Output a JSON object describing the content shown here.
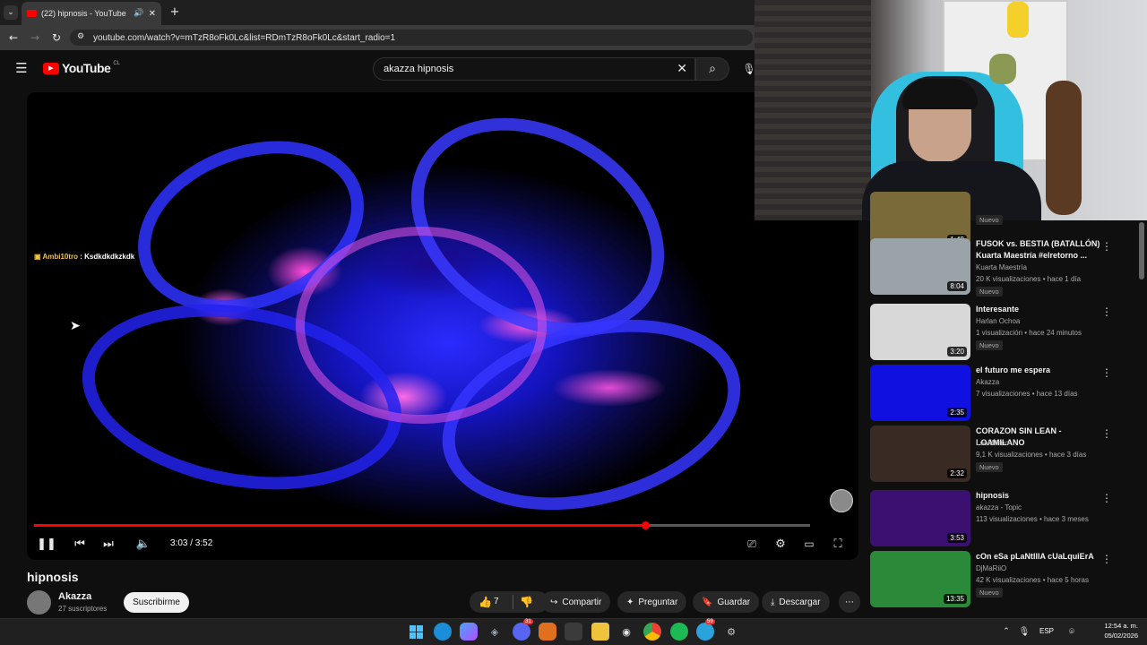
{
  "browser": {
    "tab_title": "(22) hipnosis - YouTube",
    "url": "youtube.com/watch?v=mTzR8oFk0Lc&list=RDmTzR8oFk0Lc&start_radio=1"
  },
  "header": {
    "logo_text": "YouTube",
    "country_code": "CL",
    "search_value": "akazza hipnosis"
  },
  "player": {
    "chat_user": "Ambi10tro",
    "chat_message": "Ksdkdkdkzkdk",
    "time": "3:03 / 3:52",
    "progress_fraction": 0.788
  },
  "video": {
    "title": "hipnosis",
    "channel": "Akazza",
    "subscribers": "27 suscriptores",
    "subscribe_label": "Suscribirme",
    "likes": "7",
    "share_label": "Compartir",
    "ask_label": "Preguntar",
    "save_label": "Guardar",
    "download_label": "Descargar"
  },
  "recommendations": [
    {
      "title": "",
      "channel": "",
      "meta": "",
      "badge": "Nuevo",
      "duration": "1:49",
      "thumb": "#7a6a3a"
    },
    {
      "title": "FUSOK vs. BESTIA (BATALLÓN) Kuarta Maestría #elretorno ...",
      "channel": "Kuarta Maestría",
      "meta": "20 K visualizaciones • hace 1 día",
      "badge": "Nuevo",
      "duration": "8:04",
      "thumb": "#9aa4a8"
    },
    {
      "title": "Interesante",
      "channel": "Harlan Ochoa",
      "meta": "1 visualización • hace 24 minutos",
      "badge": "Nuevo",
      "duration": "3:20",
      "thumb": "#d8d8d8"
    },
    {
      "title": "el futuro me espera",
      "channel": "Akazza",
      "meta": "7 visualizaciones • hace 13 días",
      "badge": "",
      "duration": "2:35",
      "thumb": "#1010e0"
    },
    {
      "title": "CORAZON SIN LEAN - LOAMILANO",
      "channel": "LoaMilano",
      "meta": "9,1 K visualizaciones • hace 3 días",
      "badge": "Nuevo",
      "duration": "2:32",
      "thumb": "#3a2a24"
    },
    {
      "title": "hipnosis",
      "channel": "akazza - Topic",
      "meta": "113 visualizaciones • hace 3 meses",
      "badge": "",
      "duration": "3:53",
      "thumb": "#3a1070"
    },
    {
      "title": "cOn eSa pLaNtIllA cUaLquiErA",
      "channel": "DjMaRiiO",
      "meta": "42 K visualizaciones • hace 5 horas",
      "badge": "Nuevo",
      "duration": "13:35",
      "thumb": "#2a8a3a"
    }
  ],
  "taskbar": {
    "lang": "ESP",
    "time": "12:54 a. m.",
    "date": "05/02/2026",
    "discord_badge": "31",
    "telegram_badge": "59"
  },
  "colors": {
    "accent": "#ff0000",
    "background": "#0f0f0f"
  }
}
